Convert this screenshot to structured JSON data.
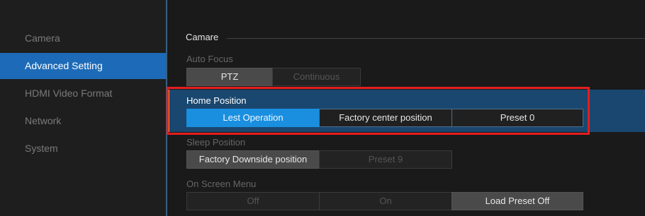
{
  "sidebar": {
    "items": [
      {
        "label": "Camera"
      },
      {
        "label": "Advanced Setting"
      },
      {
        "label": "HDMI Video Format"
      },
      {
        "label": "Network"
      },
      {
        "label": "System"
      }
    ]
  },
  "section": {
    "title": "Camare"
  },
  "auto_focus": {
    "label": "Auto Focus",
    "options": [
      "PTZ",
      "Continuous"
    ],
    "selected": "PTZ"
  },
  "home_position": {
    "label": "Home Position",
    "options": [
      "Lest Operation",
      "Factory center position",
      "Preset  0"
    ],
    "selected": "Lest Operation"
  },
  "sleep_position": {
    "label": "Sleep Position",
    "options": [
      "Factory Downside position",
      "Preset  9"
    ],
    "selected": "Factory Downside position"
  },
  "on_screen_menu": {
    "label": "On Screen Menu",
    "options": [
      "Off",
      "On",
      "Load Preset Off"
    ],
    "selected": "Load Preset Off"
  },
  "colors": {
    "active_tab": "#1d6bb8",
    "selected_option": "#1a8fe0",
    "highlight_border": "#e41e1e"
  }
}
